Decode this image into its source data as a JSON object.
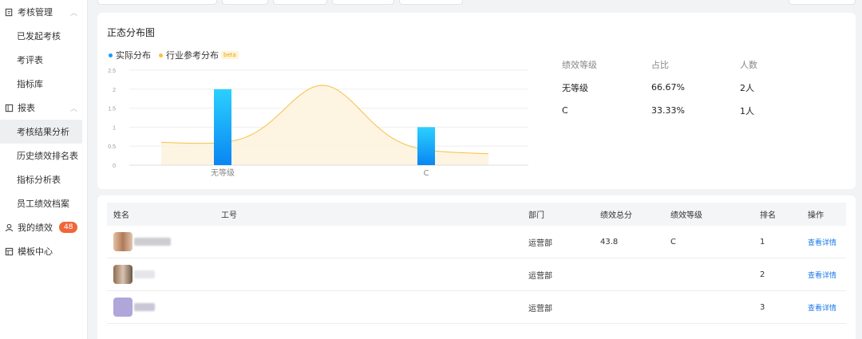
{
  "sidebar": {
    "groups": [
      {
        "label": "考核管理",
        "items": [
          "已发起考核",
          "考评表",
          "指标库"
        ]
      },
      {
        "label": "报表",
        "items": [
          "考核结果分析",
          "历史绩效排名表",
          "指标分析表",
          "员工绩效档案"
        ]
      }
    ],
    "my_performance": {
      "label": "我的绩效",
      "badge": "48"
    },
    "templates": {
      "label": "模板中心"
    }
  },
  "chart_card": {
    "title": "正态分布图",
    "legend": {
      "actual": "实际分布",
      "reference": "行业参考分布",
      "beta": "beta"
    }
  },
  "stats": {
    "headers": [
      "绩效等级",
      "占比",
      "人数"
    ],
    "rows": [
      [
        "无等级",
        "66.67%",
        "2人"
      ],
      [
        "C",
        "33.33%",
        "1人"
      ]
    ]
  },
  "chart_data": {
    "type": "bar",
    "categories": [
      "无等级",
      "C"
    ],
    "series": [
      {
        "name": "实际分布",
        "values": [
          2,
          1
        ],
        "color": "#1a9bfc"
      },
      {
        "name": "行业参考分布",
        "type": "area",
        "color": "#f5c242"
      }
    ],
    "yticks": [
      "0",
      "0.5",
      "1",
      "1.5",
      "2",
      "2.5"
    ],
    "ylim": [
      0,
      2.5
    ],
    "grid": true
  },
  "table": {
    "headers": [
      "姓名",
      "工号",
      "部门",
      "绩效总分",
      "绩效等级",
      "排名",
      "操作"
    ],
    "rows": [
      {
        "dept": "运营部",
        "score": "43.8",
        "level": "C",
        "rank": "1",
        "action": "查看详情",
        "avatar_color": "#c9a183"
      },
      {
        "dept": "运营部",
        "score": "",
        "level": "",
        "rank": "2",
        "action": "查看详情",
        "avatar_color": "#a58a6e"
      },
      {
        "dept": "运营部",
        "score": "",
        "level": "",
        "rank": "3",
        "action": "查看详情",
        "avatar_color": "#a69ccf"
      }
    ]
  }
}
